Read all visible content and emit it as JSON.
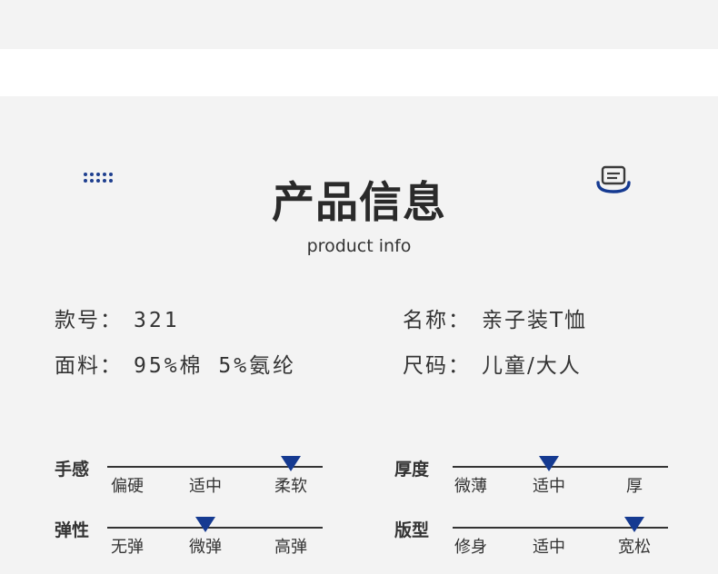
{
  "header": {
    "title": "产品信息",
    "subtitle": "product info",
    "left_icon": "dot-grid-icon",
    "right_icon": "message-box-icon",
    "accent_color": "#153a91"
  },
  "specs": {
    "model": {
      "label": "款号：",
      "value": "321"
    },
    "name": {
      "label": "名称：",
      "value": "亲子装T恤"
    },
    "fabric": {
      "label": "面料：",
      "value": "95%棉 5%氨纶"
    },
    "size": {
      "label": "尺码：",
      "value": "儿童/大人"
    }
  },
  "ratings": [
    {
      "label": "手感",
      "options": [
        "偏硬",
        "适中",
        "柔软"
      ],
      "selected_index": 2
    },
    {
      "label": "厚度",
      "options": [
        "微薄",
        "适中",
        "厚"
      ],
      "selected_index": 1
    },
    {
      "label": "弹性",
      "options": [
        "无弹",
        "微弹",
        "高弹"
      ],
      "selected_index": 1
    },
    {
      "label": "版型",
      "options": [
        "修身",
        "适中",
        "宽松"
      ],
      "selected_index": 2
    }
  ]
}
